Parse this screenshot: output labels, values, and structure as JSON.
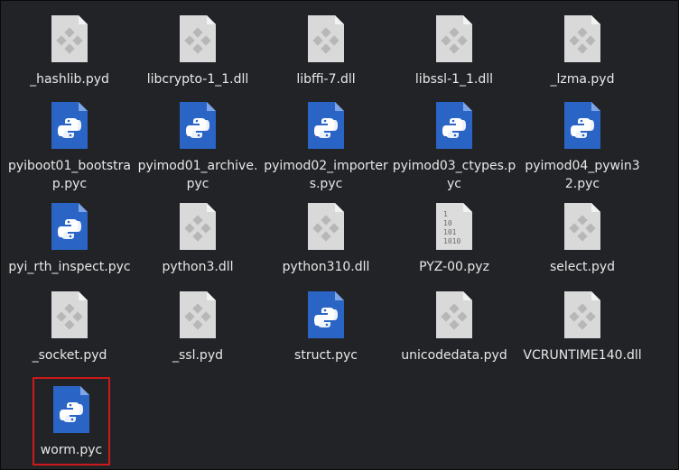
{
  "files": [
    {
      "name": "_hashlib.pyd",
      "icon": "dll-gear-icon"
    },
    {
      "name": "libcrypto-1_1.dll",
      "icon": "dll-gear-icon"
    },
    {
      "name": "libffi-7.dll",
      "icon": "dll-gear-icon"
    },
    {
      "name": "libssl-1_1.dll",
      "icon": "dll-gear-icon"
    },
    {
      "name": "_lzma.pyd",
      "icon": "dll-gear-icon"
    },
    {
      "name": "pyiboot01_bootstrap.pyc",
      "icon": "python-file-icon"
    },
    {
      "name": "pyimod01_archive.pyc",
      "icon": "python-file-icon"
    },
    {
      "name": "pyimod02_importers.pyc",
      "icon": "python-file-icon"
    },
    {
      "name": "pyimod03_ctypes.pyc",
      "icon": "python-file-icon"
    },
    {
      "name": "pyimod04_pywin32.pyc",
      "icon": "python-file-icon"
    },
    {
      "name": "pyi_rth_inspect.pyc",
      "icon": "python-file-icon"
    },
    {
      "name": "python3.dll",
      "icon": "dll-gear-icon"
    },
    {
      "name": "python310.dll",
      "icon": "dll-gear-icon"
    },
    {
      "name": "PYZ-00.pyz",
      "icon": "binary-file-icon"
    },
    {
      "name": "select.pyd",
      "icon": "dll-gear-icon"
    },
    {
      "name": "_socket.pyd",
      "icon": "dll-gear-icon"
    },
    {
      "name": "_ssl.pyd",
      "icon": "dll-gear-icon"
    },
    {
      "name": "struct.pyc",
      "icon": "python-file-icon"
    },
    {
      "name": "unicodedata.pyd",
      "icon": "dll-gear-icon"
    },
    {
      "name": "VCRUNTIME140.dll",
      "icon": "dll-gear-icon"
    },
    {
      "name": "worm.pyc",
      "icon": "python-file-icon",
      "selected": true
    }
  ],
  "binary_icon_text": [
    "1",
    "10",
    "101",
    "1010"
  ],
  "colors": {
    "background": "#222327",
    "text": "#e8e8e8",
    "python_file": "#2a64c4",
    "dll_file": "#d9d9d9",
    "selection_outline": "#cc1a1a"
  }
}
